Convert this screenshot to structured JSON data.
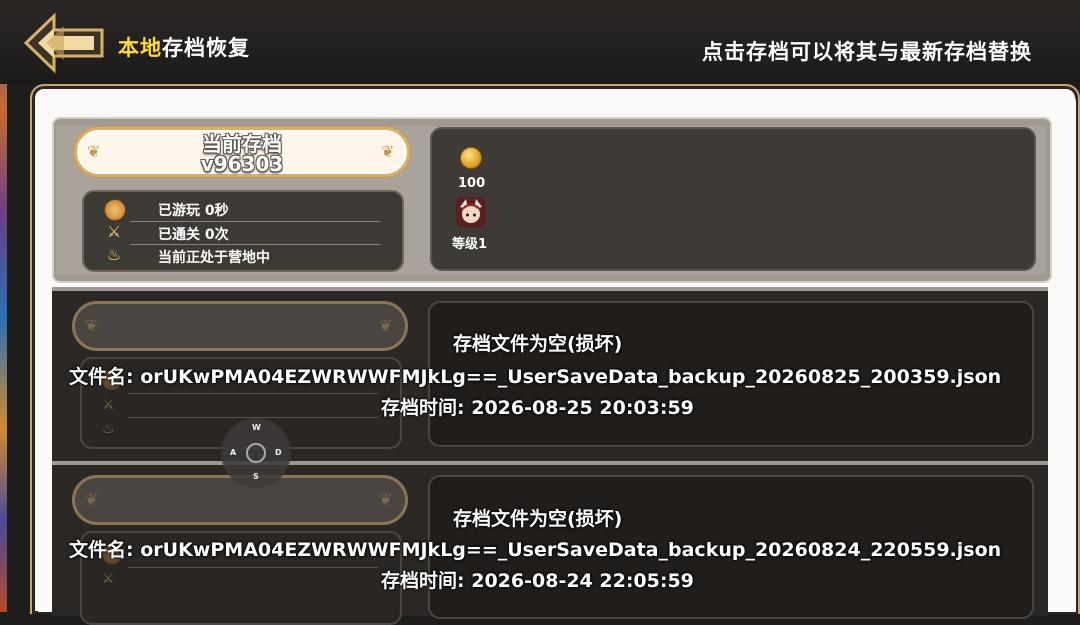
{
  "header": {
    "title_highlight": "本地",
    "title_rest": "存档恢复",
    "hint": "点击存档可以将其与最新存档替换"
  },
  "current_save": {
    "label": "当前存档",
    "version": "v96303",
    "stats": [
      {
        "icon": "clock-icon",
        "text": "已游玩 0秒"
      },
      {
        "icon": "sword-icon",
        "text": "已通关 0次"
      },
      {
        "icon": "campfire-icon",
        "text": "当前正处于营地中"
      }
    ],
    "coins": "100",
    "level": "等级1"
  },
  "backups": [
    {
      "status": "存档文件为空(损坏)",
      "filename_label": "文件名:",
      "filename": "orUKwPMA04EZWRWWFMJkLg==_UserSaveData_backup_20260825_200359.json",
      "time_label": "存档时间:",
      "time": "2026-08-25 20:03:59"
    },
    {
      "status": "存档文件为空(损坏)",
      "filename_label": "文件名:",
      "filename": "orUKwPMA04EZWRWWFMJkLg==_UserSaveData_backup_20260824_220559.json",
      "time_label": "存档时间:",
      "time": "2026-08-24 22:05:59"
    }
  ],
  "joystick": {
    "up": "W",
    "left": "A",
    "right": "D",
    "down": "S"
  }
}
